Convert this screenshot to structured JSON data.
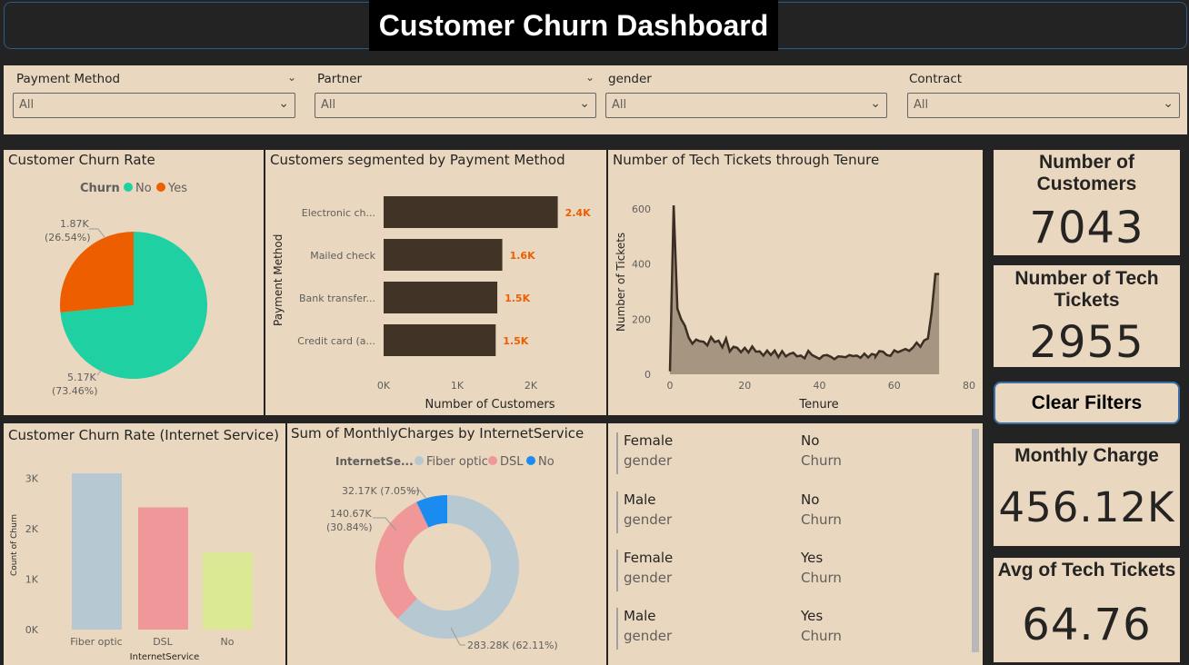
{
  "header": {
    "title": "Customer Churn Dashboard"
  },
  "slicers": [
    {
      "label": "Payment Method",
      "value": "All"
    },
    {
      "label": "Partner",
      "value": "All"
    },
    {
      "label": "gender",
      "value": "All"
    },
    {
      "label": "Contract",
      "value": "All"
    }
  ],
  "colors": {
    "no": "#1fd0a2",
    "yes": "#ec5e00",
    "bar_dark": "#413426",
    "label_orange": "#ec5e00",
    "fiber": "#b6c9d2",
    "dsl": "#f0979a",
    "no_service": "#dbe995",
    "no_blue": "#1a8cf0",
    "panel": "#e9d8bf"
  },
  "visuals": {
    "churn_rate": {
      "title": "Customer Churn Rate",
      "legend_title": "Churn",
      "legend_no": "No",
      "legend_yes": "Yes",
      "label_yes_1": "1.87K",
      "label_yes_2": "(26.54%)",
      "label_no_1": "5.17K",
      "label_no_2": "(73.46%)"
    },
    "payment": {
      "title": "Customers segmented by Payment Method",
      "ylabel": "Payment Method",
      "xlabel": "Number of Customers",
      "ticks": [
        "0K",
        "1K",
        "2K"
      ]
    },
    "tickets": {
      "title": "Number of Tech Tickets through Tenure",
      "ylabel": "Number of Tickets",
      "xlabel": "Tenure"
    },
    "internet_churn": {
      "title": "Customer Churn Rate (Internet Service)",
      "ylabel": "Count of Churn",
      "xlabel": "InternetService"
    },
    "monthly": {
      "title": "Sum of MonthlyCharges by InternetService",
      "legend_title": "InternetSe...",
      "legend_1": "Fiber optic",
      "legend_2": "DSL",
      "legend_3": "No",
      "label_no": "32.17K (7.05%)",
      "label_dsl_1": "140.67K",
      "label_dsl_2": "(30.84%)",
      "label_fiber": "283.28K (62.11%)"
    }
  },
  "cards": [
    {
      "value": "Female",
      "label": "gender",
      "value2": "No",
      "label2": "Churn"
    },
    {
      "value": "Male",
      "label": "gender",
      "value2": "No",
      "label2": "Churn"
    },
    {
      "value": "Female",
      "label": "gender",
      "value2": "Yes",
      "label2": "Churn"
    },
    {
      "value": "Male",
      "label": "gender",
      "value2": "Yes",
      "label2": "Churn"
    }
  ],
  "kpis": {
    "customers": {
      "title": "Number of Customers",
      "value": "7043"
    },
    "tickets": {
      "title": "Number of Tech Tickets",
      "value": "2955"
    },
    "clear": {
      "label": "Clear Filters"
    },
    "monthly": {
      "title": "Monthly Charge",
      "value": "456.12K"
    },
    "avg": {
      "title": "Avg of Tech Tickets",
      "value": "64.76"
    }
  },
  "chart_data": [
    {
      "type": "pie",
      "title": "Customer Churn Rate",
      "legend_title": "Churn",
      "categories": [
        "No",
        "Yes"
      ],
      "values": [
        5170,
        1870
      ],
      "labels": [
        "5.17K (73.46%)",
        "1.87K (26.54%)"
      ],
      "percents": [
        73.46,
        26.54
      ]
    },
    {
      "type": "bar",
      "orientation": "horizontal",
      "title": "Customers segmented by Payment Method",
      "xlabel": "Number of Customers",
      "ylabel": "Payment Method",
      "categories": [
        "Electronic ch...",
        "Mailed check",
        "Bank transfer...",
        "Credit card (a..."
      ],
      "values": [
        2365,
        1612,
        1544,
        1522
      ],
      "data_labels": [
        "2.4K",
        "1.6K",
        "1.5K",
        "1.5K"
      ],
      "xlim": [
        0,
        2500
      ],
      "xticks": [
        "0K",
        "1K",
        "2K"
      ]
    },
    {
      "type": "area",
      "title": "Number of Tech Tickets through Tenure",
      "xlabel": "Tenure",
      "ylabel": "Number of Tickets",
      "xlim": [
        0,
        80
      ],
      "ylim": [
        0,
        650
      ],
      "xticks": [
        0,
        20,
        40,
        60,
        80
      ],
      "yticks": [
        0,
        200,
        400,
        600
      ],
      "x": [
        0,
        1,
        2,
        3,
        4,
        5,
        6,
        7,
        8,
        9,
        10,
        11,
        12,
        13,
        14,
        15,
        16,
        17,
        18,
        19,
        20,
        21,
        22,
        23,
        24,
        25,
        26,
        27,
        28,
        29,
        30,
        31,
        32,
        33,
        34,
        35,
        36,
        37,
        38,
        39,
        40,
        41,
        42,
        43,
        44,
        45,
        46,
        47,
        48,
        49,
        50,
        51,
        52,
        53,
        54,
        55,
        55,
        56,
        57,
        58,
        59,
        60,
        61,
        62,
        63,
        64,
        65,
        66,
        67,
        68,
        69,
        70,
        71,
        72
      ],
      "y": [
        11,
        613,
        238,
        200,
        176,
        133,
        111,
        126,
        120,
        118,
        105,
        135,
        117,
        122,
        98,
        130,
        83,
        100,
        96,
        80,
        96,
        79,
        101,
        82,
        83,
        68,
        86,
        70,
        86,
        62,
        84,
        65,
        74,
        78,
        65,
        68,
        58,
        85,
        70,
        63,
        56,
        68,
        70,
        64,
        55,
        65,
        64,
        62,
        70,
        66,
        68,
        60,
        75,
        61,
        74,
        70,
        65,
        84,
        82,
        70,
        67,
        87,
        80,
        86,
        92,
        85,
        97,
        115,
        100,
        123,
        130,
        225,
        364,
        364
      ]
    },
    {
      "type": "bar",
      "title": "Customer Churn Rate (Internet Service)",
      "xlabel": "InternetService",
      "ylabel": "Count of Churn",
      "categories": [
        "Fiber optic",
        "DSL",
        "No"
      ],
      "values": [
        3096,
        2421,
        1526
      ],
      "ylim": [
        0,
        3200
      ],
      "yticks": [
        "0K",
        "1K",
        "2K",
        "3K"
      ]
    },
    {
      "type": "pie",
      "variant": "donut",
      "title": "Sum of MonthlyCharges by InternetService",
      "legend_title": "InternetSe...",
      "categories": [
        "Fiber optic",
        "DSL",
        "No"
      ],
      "values": [
        283280,
        140670,
        32170
      ],
      "labels": [
        "283.28K (62.11%)",
        "140.67K (30.84%)",
        "32.17K (7.05%)"
      ],
      "percents": [
        62.11,
        30.84,
        7.05
      ]
    }
  ]
}
